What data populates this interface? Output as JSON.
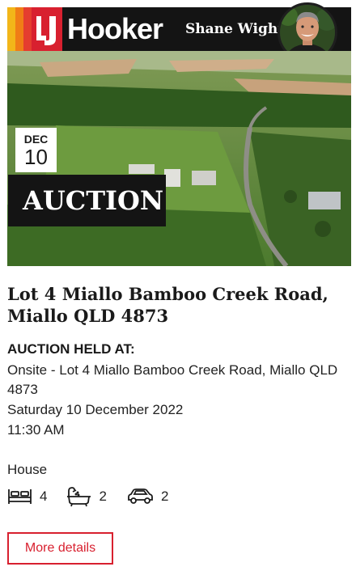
{
  "header": {
    "brand": "Hooker",
    "agent_name": "Shane Wight",
    "brand_colors": [
      "#f2b619",
      "#f07d16",
      "#e53d2f",
      "#d8202f"
    ],
    "logo_icon": "lj-monogram-icon",
    "avatar_icon": "agent-avatar"
  },
  "listing": {
    "date_month": "DEC",
    "date_day": "10",
    "status_banner": "AUCTION",
    "title_line1": "Lot 4 Miallo Bamboo Creek Road,",
    "title_line2": "Miallo QLD 4873",
    "auction_heading": "AUCTION HELD AT:",
    "venue_line1": "Onsite - Lot 4 Miallo Bamboo Creek Road, Miallo QLD",
    "venue_line2": "4873",
    "auction_date": "Saturday 10 December 2022",
    "auction_time": "11:30 AM",
    "property_type": "House",
    "features": {
      "bedrooms": "4",
      "bathrooms": "2",
      "car_spaces": "2",
      "bed_icon": "bed-icon",
      "bath_icon": "bath-icon",
      "car_icon": "car-icon"
    },
    "more_details_label": "More details",
    "accent_color": "#d8202f"
  }
}
